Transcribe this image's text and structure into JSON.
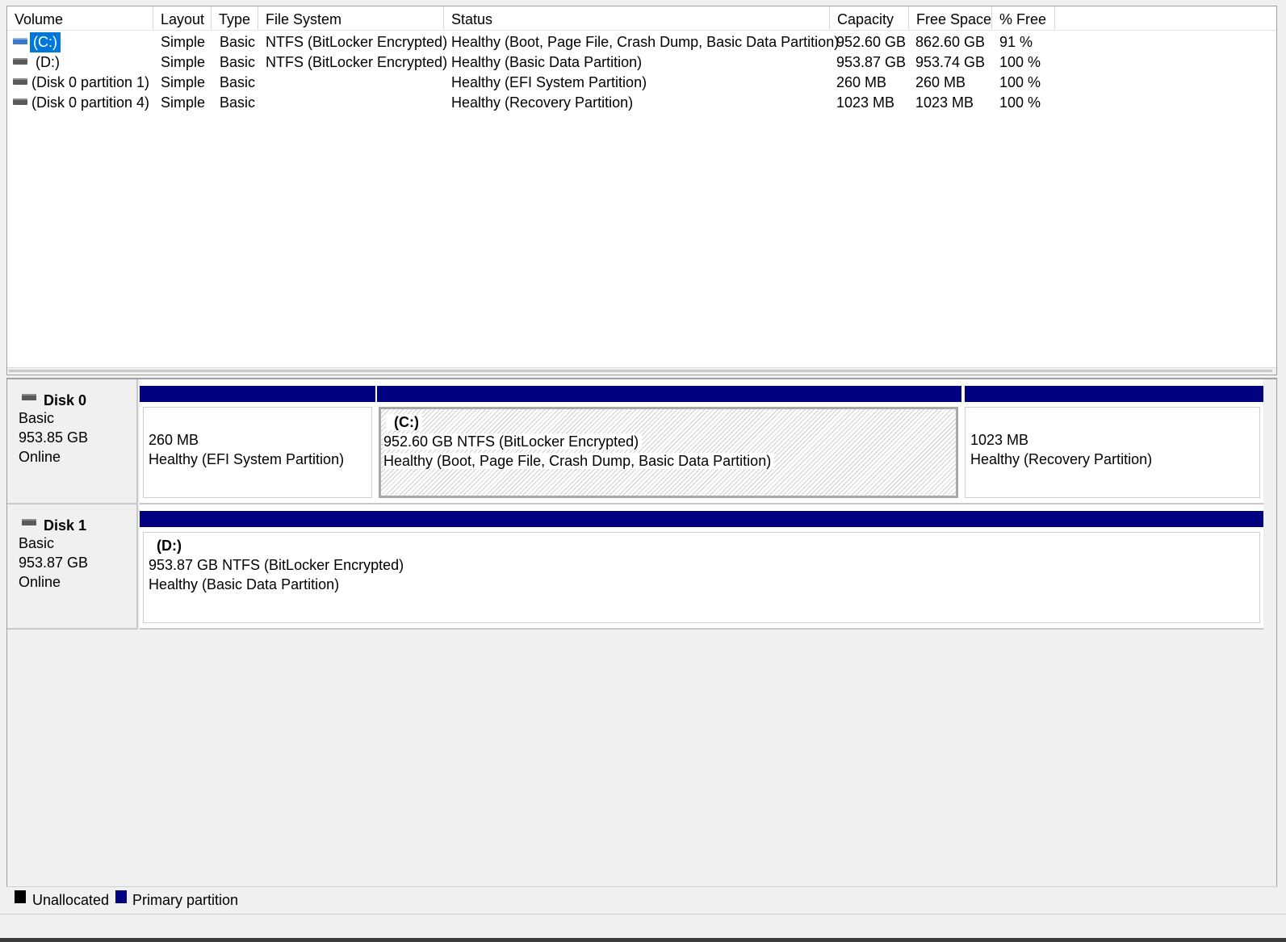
{
  "volume_list": {
    "columns": [
      "Volume",
      "Layout",
      "Type",
      "File System",
      "Status",
      "Capacity",
      "Free Space",
      "% Free"
    ],
    "rows": [
      {
        "icon": "drive-blue-icon",
        "volume": "(C:)",
        "layout": "Simple",
        "type": "Basic",
        "file_system": "NTFS (BitLocker Encrypted)",
        "status": "Healthy (Boot, Page File, Crash Dump, Basic Data Partition)",
        "capacity": "952.60 GB",
        "free_space": "862.60 GB",
        "percent_free": "91 %"
      },
      {
        "icon": "drive-icon",
        "volume": "(D:)",
        "layout": "Simple",
        "type": "Basic",
        "file_system": "NTFS (BitLocker Encrypted)",
        "status": "Healthy (Basic Data Partition)",
        "capacity": "953.87 GB",
        "free_space": "953.74 GB",
        "percent_free": "100 %"
      },
      {
        "icon": "drive-icon",
        "volume": "(Disk 0 partition 1)",
        "layout": "Simple",
        "type": "Basic",
        "file_system": "",
        "status": "Healthy (EFI System Partition)",
        "capacity": "260 MB",
        "free_space": "260 MB",
        "percent_free": "100 %"
      },
      {
        "icon": "drive-icon",
        "volume": "(Disk 0 partition 4)",
        "layout": "Simple",
        "type": "Basic",
        "file_system": "",
        "status": "Healthy (Recovery Partition)",
        "capacity": "1023 MB",
        "free_space": "1023 MB",
        "percent_free": "100 %"
      }
    ],
    "selected_row": 0
  },
  "disks": [
    {
      "name": "Disk 0",
      "type": "Basic",
      "size": "953.85 GB",
      "state": "Online",
      "partitions": [
        {
          "title": "",
          "size_line": "260 MB",
          "status_line": "Healthy (EFI System Partition)"
        },
        {
          "title": "(C:)",
          "size_line": "952.60 GB NTFS (BitLocker Encrypted)",
          "status_line": "Healthy (Boot, Page File, Crash Dump, Basic Data Partition)"
        },
        {
          "title": "",
          "size_line": "1023 MB",
          "status_line": "Healthy (Recovery Partition)"
        }
      ]
    },
    {
      "name": "Disk 1",
      "type": "Basic",
      "size": "953.87 GB",
      "state": "Online",
      "partitions": [
        {
          "title": "(D:)",
          "size_line": "953.87 GB NTFS (BitLocker Encrypted)",
          "status_line": "Healthy (Basic Data Partition)"
        }
      ]
    }
  ],
  "legend": [
    {
      "label": "Unallocated",
      "color": "#000000"
    },
    {
      "label": "Primary partition",
      "color": "#000080"
    }
  ],
  "colors": {
    "primary_partition": "#000080",
    "selection": "#0078d7"
  }
}
